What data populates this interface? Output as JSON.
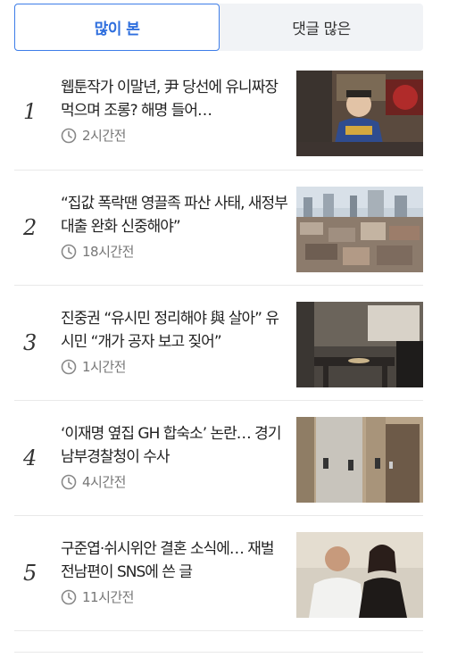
{
  "tabs": [
    {
      "label": "많이 본",
      "active": true
    },
    {
      "label": "댓글 많은",
      "active": false
    }
  ],
  "articles": [
    {
      "rank": "1",
      "title": "웹툰작가 이말년, 尹 당선에 유니짜장 먹으며 조롱? 해명 들어…",
      "time": "2시간전"
    },
    {
      "rank": "2",
      "title": "“집값 폭락땐 영끌족 파산 사태, 새정부 대출 완화 신중해야”",
      "time": "18시간전"
    },
    {
      "rank": "3",
      "title": "진중권 “유시민 정리해야 與 살아” 유시민 “개가 공자 보고 짖어”",
      "time": "1시간전"
    },
    {
      "rank": "4",
      "title": "‘이재명 옆집 GH 합숙소’ 논란… 경기남부경찰청이 수사",
      "time": "4시간전"
    },
    {
      "rank": "5",
      "title": "구준엽·쉬시위안 결혼 소식에… 재벌 전남편이 SNS에 쓴 글",
      "time": "11시간전"
    }
  ],
  "colors": {
    "accent": "#2f6fde",
    "tab_bg": "#f1f3f6",
    "meta": "#777777"
  }
}
